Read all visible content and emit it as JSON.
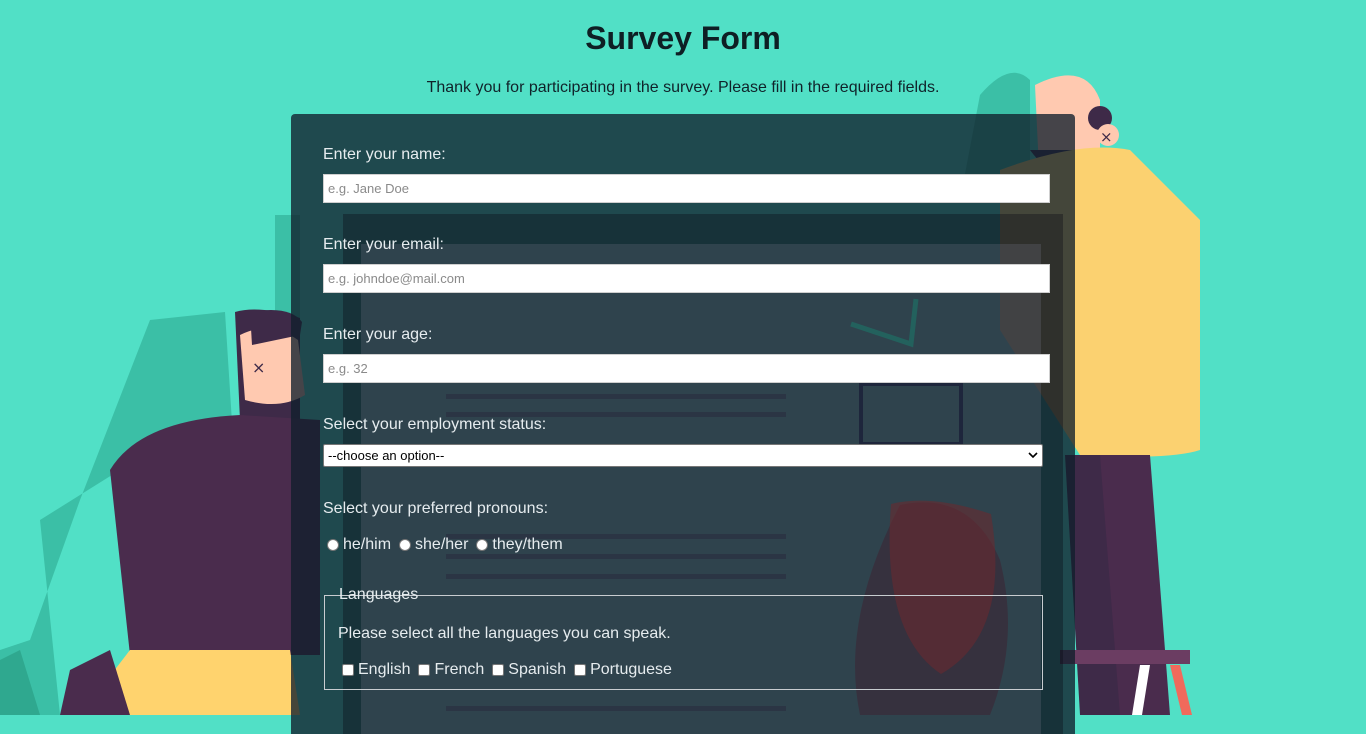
{
  "page": {
    "title": "Survey Form",
    "description": "Thank you for participating in the survey. Please fill in the required fields."
  },
  "form": {
    "name": {
      "label": "Enter your name:",
      "placeholder": "e.g. Jane Doe",
      "value": ""
    },
    "email": {
      "label": "Enter your email:",
      "placeholder": "e.g. johndoe@mail.com",
      "value": ""
    },
    "age": {
      "label": "Enter your age:",
      "placeholder": "e.g. 32",
      "value": ""
    },
    "employment": {
      "label": "Select your employment status:",
      "selected": "--choose an option--"
    },
    "pronouns": {
      "label": "Select your preferred pronouns:",
      "options": [
        "he/him",
        "she/her",
        "they/them"
      ]
    },
    "languages": {
      "legend": "Languages",
      "description": "Please select all the languages you can speak.",
      "options": [
        "English",
        "French",
        "Spanish",
        "Portuguese"
      ]
    }
  },
  "colors": {
    "background": "#51e0c6",
    "panel": "#111f2c"
  },
  "icons": {
    "select_chevron": "chevron-down-icon"
  }
}
